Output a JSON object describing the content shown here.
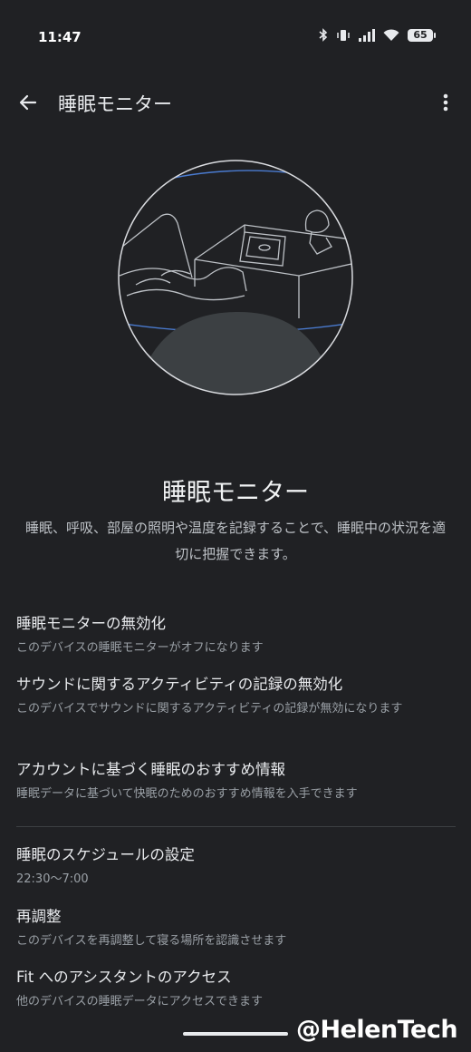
{
  "status_bar": {
    "time": "11:47",
    "battery": "65",
    "icons": [
      "bluetooth-icon",
      "vibrate-icon",
      "signal-icon",
      "wifi-icon",
      "battery-icon"
    ]
  },
  "app_bar": {
    "title": "睡眠モニター",
    "back_icon": "arrow-back-icon",
    "more_icon": "more-vert-icon"
  },
  "hero": {
    "title": "睡眠モニター",
    "description": "睡眠、呼吸、部屋の照明や温度を記録することで、睡眠中の状況を適切に把握できます。"
  },
  "settings": [
    {
      "title": "睡眠モニターの無効化",
      "subtitle": "このデバイスの睡眠モニターがオフになります"
    },
    {
      "title": "サウンドに関するアクティビティの記録の無効化",
      "subtitle": "このデバイスでサウンドに関するアクティビティの記録が無効になります"
    },
    {
      "title": "アカウントに基づく睡眠のおすすめ情報",
      "subtitle": "睡眠データに基づいて快眠のためのおすすめ情報を入手できます"
    },
    {
      "title": "睡眠のスケジュールの設定",
      "subtitle": "22:30〜7:00"
    },
    {
      "title": "再調整",
      "subtitle": "このデバイスを再調整して寝る場所を認識させます"
    },
    {
      "title": "Fit へのアシスタントのアクセス",
      "subtitle": "他のデバイスの睡眠データにアクセスできます"
    }
  ],
  "watermark": "@HelenTech",
  "colors": {
    "background": "#202124",
    "text_primary": "#e8eaed",
    "text_secondary": "#9aa0a6",
    "accent_line": "#4a7bd0"
  }
}
